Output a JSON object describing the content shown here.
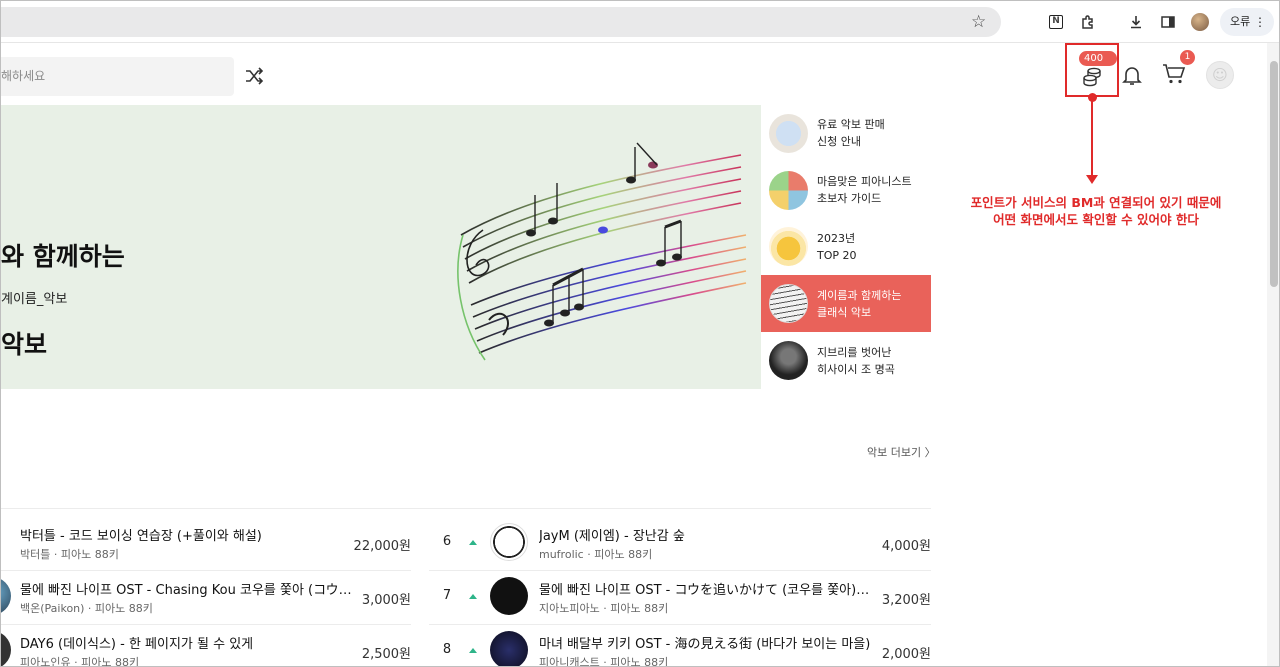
{
  "browser": {
    "profile_label": "오류",
    "menu_icon": "more-vert-icon"
  },
  "header": {
    "search_placeholder": "해하세요",
    "points_badge": "400원",
    "cart_count": "1"
  },
  "annotation": {
    "line1": "포인트가 서비스의 BM과 연결되어 있기 때문에",
    "line2": "어떤 화면에서도 확인할 수 있어야 한다"
  },
  "banner": {
    "title_line1": "와 함께하는",
    "title_line2": "악보",
    "subtitle": "계이름_악보"
  },
  "side_items": [
    {
      "label": "유료 악보 판매\n신청 안내",
      "active": false
    },
    {
      "label": "마음맞은 피아니스트\n초보자 가이드",
      "active": false
    },
    {
      "label": "2023년\nTOP 20",
      "active": false
    },
    {
      "label": "계이름과 함께하는\n클래식 악보",
      "active": true
    },
    {
      "label": "지브리를 벗어난\n히사이시 조 명곡",
      "active": false
    }
  ],
  "chart": {
    "more_label": "악보 더보기",
    "left_rows": [
      {
        "title": "박터틀 - 코드 보이싱 연습장 (+풀이와 해설)",
        "meta": "박터틀 · 피아노 88키",
        "price": "22,000원"
      },
      {
        "title": "물에 빠진 나이프 OST - Chasing Kou 코우를 쫓아 (コウを追...",
        "meta": "백온(Paikon) · 피아노 88키",
        "price": "3,000원"
      },
      {
        "title": "DAY6 (데이식스) - 한 페이지가 될 수 있게",
        "meta": "피아노인유 · 피아노 88키",
        "price": "2,500원"
      }
    ],
    "right_rows": [
      {
        "rank": "6",
        "title": "JayM (제이엠) - 장난감 숲",
        "meta": "mufrolic · 피아노 88키",
        "price": "4,000원"
      },
      {
        "rank": "7",
        "title": "물에 빠진 나이프 OST - コウを追いかけて (코우를 쫓아) (계...",
        "meta": "지아노피아노 · 피아노 88키",
        "price": "3,200원"
      },
      {
        "rank": "8",
        "title": "마녀 배달부 키키 OST - 海の見える街 (바다가 보이는 마을)",
        "meta": "피아니캐스트 · 피아노 88키",
        "price": "2,000원"
      }
    ]
  }
}
